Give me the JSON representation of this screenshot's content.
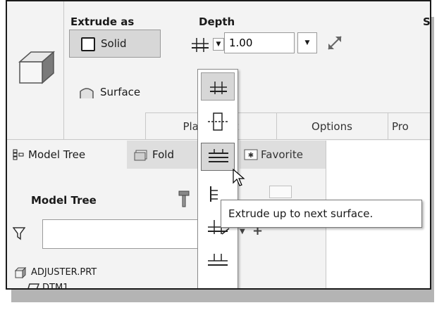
{
  "ribbon": {
    "extrude_group_title": "Extrude as",
    "depth_group_title": "Depth",
    "third_group_title_partial": "S",
    "solid_label": "Solid",
    "surface_label": "Surface",
    "depth_value": "1.00",
    "tabs": [
      {
        "label": "Placement"
      },
      {
        "label": "Options"
      },
      {
        "label": "Pro"
      }
    ]
  },
  "panel": {
    "tabs": [
      {
        "label": "Model Tree"
      },
      {
        "label": "Fold"
      },
      {
        "label": "Favorite"
      }
    ],
    "tree_title": "Model Tree",
    "filter_value": "",
    "clear_glyph": "×",
    "items": [
      {
        "label": "ADJUSTER.PRT"
      },
      {
        "label": "DTM1"
      }
    ]
  },
  "depth_menu": {
    "items": [
      {
        "icon": "blind-depth-icon"
      },
      {
        "icon": "symmetric-depth-icon"
      },
      {
        "icon": "to-next-depth-icon"
      },
      {
        "icon": "through-all-depth-icon"
      },
      {
        "icon": "through-until-depth-icon"
      },
      {
        "icon": "to-selected-depth-icon"
      }
    ],
    "hovered_index": 2
  },
  "tooltip": {
    "text": "Extrude up to next surface."
  }
}
